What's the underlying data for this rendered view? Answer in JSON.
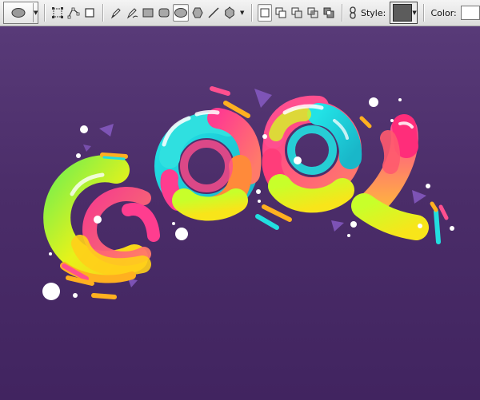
{
  "toolbar": {
    "tool_preset_icon": "ellipse-tool-icon",
    "path_mode_icons": [
      "shape-layers-icon",
      "paths-icon",
      "fill-pixels-icon"
    ],
    "draw_tool_icons": [
      "pen-icon",
      "freeform-pen-icon",
      "rectangle-icon",
      "rounded-rectangle-icon",
      "ellipse-icon",
      "polygon-icon",
      "line-icon",
      "custom-shape-icon"
    ],
    "combine_mode_icons": [
      "new-layer-icon",
      "add-to-shape-icon",
      "subtract-icon",
      "intersect-icon",
      "exclude-icon"
    ],
    "link_icon": "link-icon",
    "style_label": "Style:",
    "color_label": "Color:",
    "style_value_color": "#5c5c5c",
    "color_value": "#ffffff"
  },
  "canvas": {
    "artwork_text": "COOL",
    "background_top": "#583a78",
    "background_bottom": "#412460"
  }
}
